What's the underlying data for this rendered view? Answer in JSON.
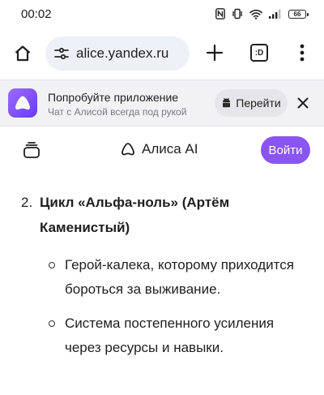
{
  "status_bar": {
    "time": "00:02",
    "battery": "66",
    "icons": [
      "nfc-icon",
      "vibrate-icon",
      "wifi-icon",
      "signal-icon",
      "battery-icon"
    ]
  },
  "browser": {
    "url": "alice.yandex.ru",
    "tabs_label": ":D",
    "icons": [
      "home-icon",
      "site-settings-icon",
      "new-tab-plus-icon",
      "tabs-icon",
      "more-vert-icon"
    ]
  },
  "banner": {
    "title": "Попробуйте приложение",
    "subtitle": "Чат с Алисой всегда под рукой",
    "open_label": "Перейти",
    "icons": [
      "alice-app-icon",
      "android-icon",
      "close-icon"
    ]
  },
  "header": {
    "brand": "Алиса AI",
    "login": "Войти",
    "accent_color": "#8a55f5",
    "icons": [
      "history-icon",
      "alice-logo-icon"
    ]
  },
  "content": {
    "item_number": "2.",
    "item_title": "Цикл «Альфа-ноль» (Артём Каменистый)",
    "bullets": [
      "Герой-калека, которому приходится бороться за выживание.",
      "Система постепенного усиления через ресурсы и навыки."
    ]
  }
}
